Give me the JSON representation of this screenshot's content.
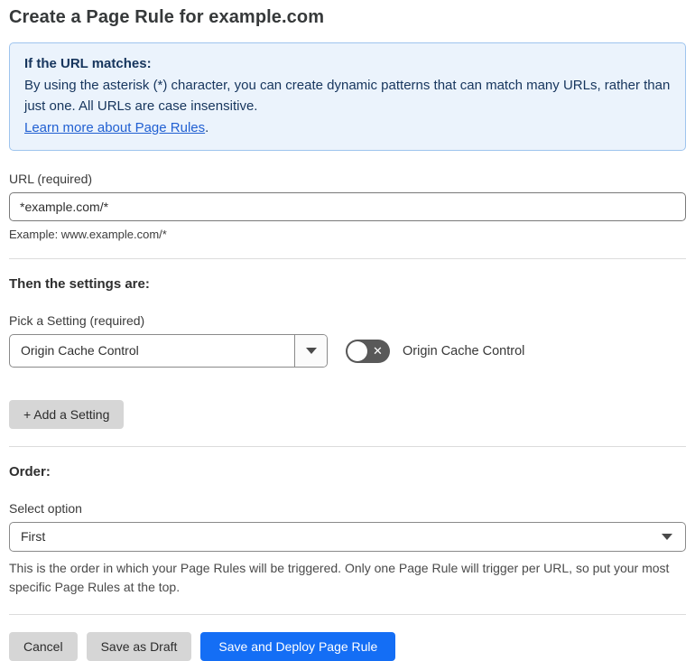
{
  "page": {
    "title": "Create a Page Rule for example.com"
  },
  "info_box": {
    "heading": "If the URL matches:",
    "body": "By using the asterisk (*) character, you can create dynamic patterns that can match many URLs, rather than just one. All URLs are case insensitive.",
    "link_text": "Learn more about Page Rules",
    "link_suffix": "."
  },
  "url_section": {
    "label": "URL (required)",
    "value": "*example.com/*",
    "hint": "Example: www.example.com/*"
  },
  "settings_section": {
    "heading": "Then the settings are:",
    "pick_label": "Pick a Setting (required)",
    "selected_setting": "Origin Cache Control",
    "toggle_label": "Origin Cache Control",
    "toggle_state": "off",
    "toggle_x": "✕",
    "add_button_label": "+ Add a Setting"
  },
  "order_section": {
    "heading": "Order:",
    "label": "Select option",
    "selected_option": "First",
    "help": "This is the order in which your Page Rules will be triggered. Only one Page Rule will trigger per URL, so put your most specific Page Rules at the top."
  },
  "footer": {
    "cancel_label": "Cancel",
    "save_draft_label": "Save as Draft",
    "save_deploy_label": "Save and Deploy Page Rule"
  },
  "colors": {
    "accent_blue": "#146ef5",
    "info_bg": "#ebf3fc",
    "info_border": "#9ec4ee",
    "info_text": "#16355d",
    "link_blue": "#2160d2",
    "toggle_bg": "#595959",
    "button_gray": "#d6d6d6"
  }
}
